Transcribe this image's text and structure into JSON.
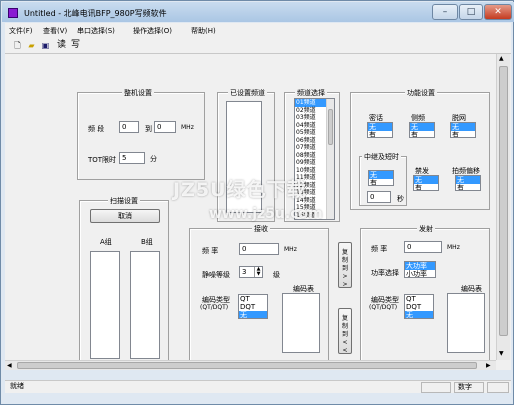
{
  "window": {
    "title": "Untitled - 北峰电讯BFP_980P写频软件"
  },
  "title_buttons": {
    "minimize": "–",
    "maximize": "□",
    "close": "✕"
  },
  "menu": [
    "文件(F)",
    "查看(V)",
    "串口选择(S)",
    "操作选择(O)",
    "帮助(H)"
  ],
  "toolbar": {
    "new_icon": "new-file-icon",
    "open_icon": "open-folder-icon",
    "save_icon": "save-disk-icon",
    "read": "读",
    "write": "写"
  },
  "machine_settings": {
    "title": "整机设置",
    "band_label": "频  段",
    "band_from": "0",
    "to_label": "到",
    "band_to": "0",
    "mhz": "MHz",
    "tot_label": "TOT限时",
    "tot_value": "5",
    "minute": "分"
  },
  "set_channels": {
    "title": "已设置频道"
  },
  "channel_select": {
    "title": "频道选择",
    "items": [
      "01频道",
      "02频道",
      "03频道",
      "04频道",
      "05频道",
      "06频道",
      "07频道",
      "08频道",
      "09频道",
      "10频道",
      "11频道",
      "12频道",
      "13频道",
      "14频道",
      "15频道",
      "16频道"
    ]
  },
  "function_settings": {
    "title": "功能设置",
    "encrypt_label": "密话",
    "encrypt_items": [
      "无",
      "有"
    ],
    "side_label": "侧频",
    "side_items": [
      "无",
      "有"
    ],
    "offnet_label": "脱网",
    "offnet_items": [
      "无",
      "有"
    ],
    "relay_label": "中继及短时",
    "relay_items": [
      "无",
      "有"
    ],
    "busy_label": "禁发",
    "busy_items": [
      "无",
      "有"
    ],
    "quiet_label": "拍频偏移",
    "quiet_items": [
      "无",
      "有"
    ],
    "seconds_value": "0",
    "seconds": "秒"
  },
  "scan_settings": {
    "title": "扫描设置",
    "cancel": "取消",
    "group_a": "A组",
    "group_b": "B组"
  },
  "receive": {
    "title": "接收",
    "freq_label": "频  率",
    "freq_value": "0",
    "mhz": "MHz",
    "squelch_label": "静噪等级",
    "squelch_value": "3",
    "squelch_unit": "级",
    "code_type_label": "编码类型",
    "code_type_sub": "(QT/DQT)",
    "code_type_items": [
      "QT",
      "DQT",
      "无"
    ],
    "code_table": "编码表"
  },
  "copy_buttons": {
    "to_tx": "复制到>>",
    "to_rx": "复制到<<"
  },
  "transmit": {
    "title": "发射",
    "freq_label": "频  率",
    "freq_value": "0",
    "mhz": "MHz",
    "power_label": "功率选择",
    "power_items": [
      "大功率",
      "小功率"
    ],
    "code_type_label": "编码类型",
    "code_type_sub": "(QT/DQT)",
    "code_type_items": [
      "QT",
      "DQT",
      "无"
    ],
    "code_table": "编码表"
  },
  "status": {
    "ready": "就绪",
    "num": "数字"
  },
  "watermark": {
    "line1": "JZ5U绿色下载",
    "line2": "www.jz5u.com"
  },
  "colors": {
    "selection": "#3399ff",
    "titlebar": "#bcd2ea",
    "face": "#f0f0f0"
  }
}
